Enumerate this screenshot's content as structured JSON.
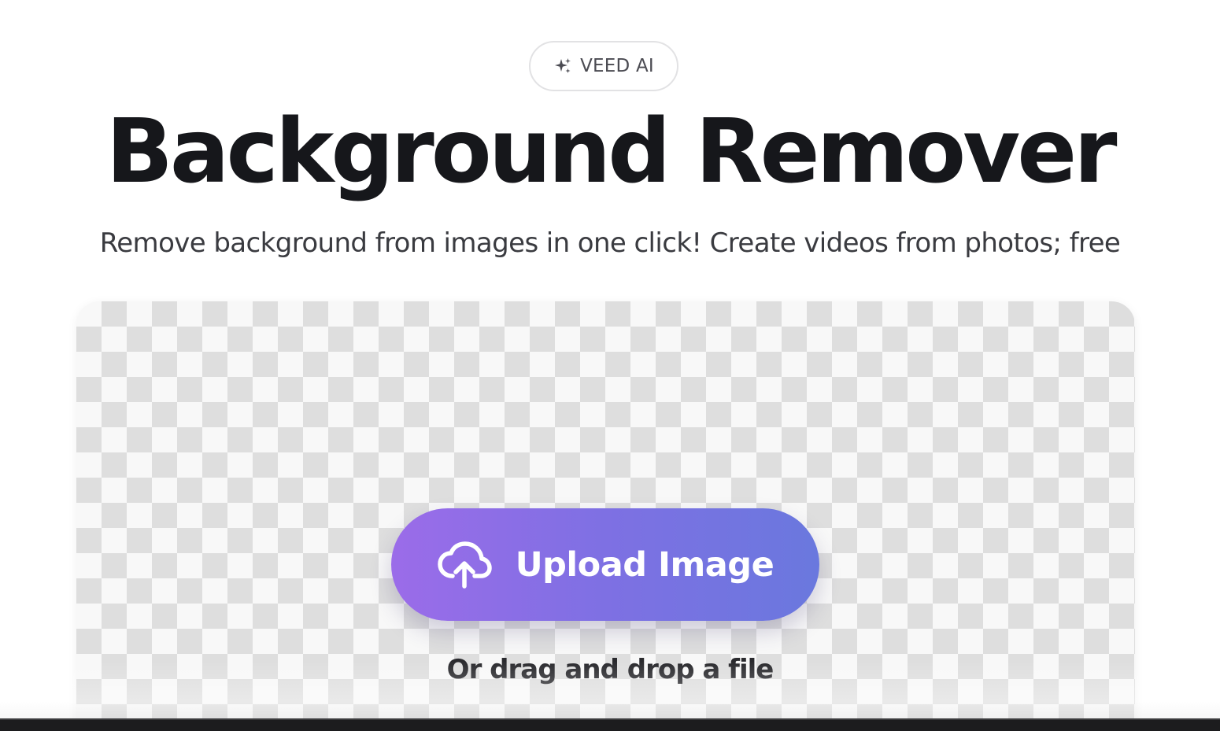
{
  "badge": {
    "icon": "sparkles-icon",
    "label": "VEED AI"
  },
  "hero": {
    "title": "Background Remover",
    "subtitle": "Remove background from images in one click! Create videos from photos; free"
  },
  "dropzone": {
    "upload_button_icon": "cloud-upload-icon",
    "upload_button_label": "Upload Image",
    "drag_hint": "Or drag and drop a file"
  },
  "colors": {
    "button_gradient_start": "#9b6ce9",
    "button_gradient_end": "#6a78de",
    "title_text": "#16171b",
    "checker_light": "#f8f8f8",
    "checker_dark": "#dedede"
  }
}
